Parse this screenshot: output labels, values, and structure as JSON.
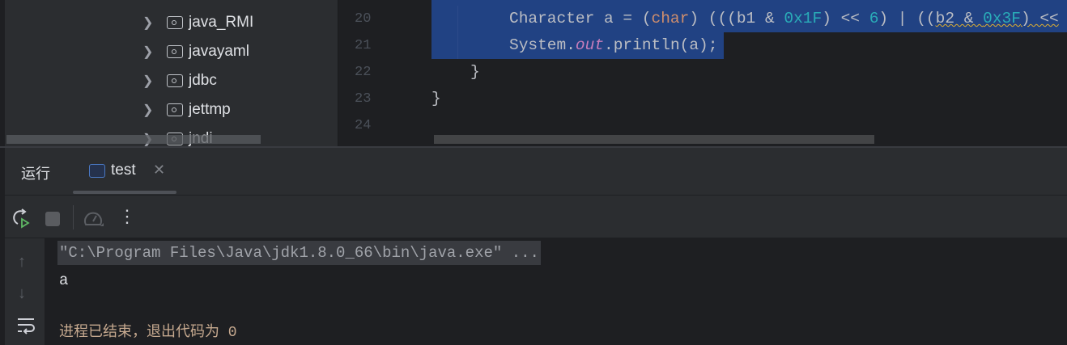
{
  "project_tree": {
    "items": [
      {
        "label": "java_RMI"
      },
      {
        "label": "javayaml"
      },
      {
        "label": "jdbc"
      },
      {
        "label": "jettmp"
      },
      {
        "label": "jndi"
      }
    ]
  },
  "editor": {
    "line_numbers": [
      "20",
      "21",
      "22",
      "23",
      "24"
    ],
    "code": {
      "l20_a": "Character a = (",
      "l20_kw": "char",
      "l20_b": ") (((b1 & ",
      "l20_n1": "0x1F",
      "l20_c": ") << ",
      "l20_n2": "6",
      "l20_d": ") | ((",
      "l20_e": "b2 & ",
      "l20_n3": "0x3F",
      "l20_f": ") <<",
      "l21_a": "System.",
      "l21_fld": "out",
      "l21_b": ".println(a);",
      "l22": "}",
      "l23": "}"
    }
  },
  "run_panel": {
    "title": "运行",
    "tab_label": "test",
    "console": {
      "command": "\"C:\\Program Files\\Java\\jdk1.8.0_66\\bin\\java.exe\" ...",
      "output": "a",
      "exit_message": "进程已结束，退出代码为 0"
    }
  }
}
